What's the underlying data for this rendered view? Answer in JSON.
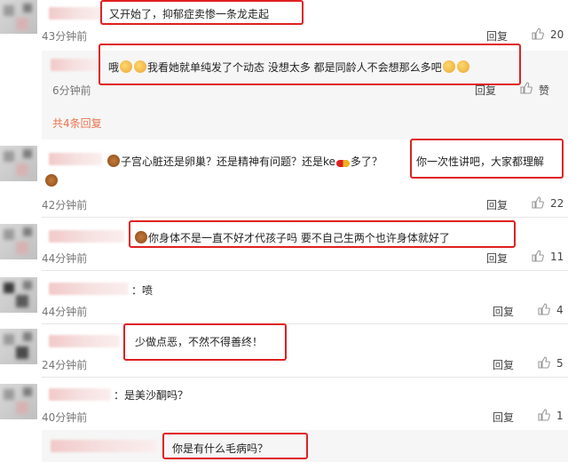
{
  "comments": [
    {
      "time": "43分钟前",
      "reply": "回复",
      "likes": "20",
      "text": "又开始了，抑郁症卖惨一条龙走起"
    },
    {
      "time": "6分钟前",
      "reply": "回复",
      "likes": "赞",
      "text": "哦我看她就单纯发了个动态 没想太多 都是同龄人不会想那么多吧"
    },
    {
      "more": "共4条回复"
    },
    {
      "time": "42分钟前",
      "reply": "回复",
      "likes": "22",
      "text_a": "子宫心脏还是卵巢？还是精神有问题？还是ke",
      "text_b": "多了？",
      "text_c": "你一次性讲吧，大家都理解"
    },
    {
      "time": "44分钟前",
      "reply": "回复",
      "likes": "11",
      "text": "你身体不是一直不好才代孩子吗  要不自己生两个也许身体就好了"
    },
    {
      "time": "44分钟前",
      "reply": "回复",
      "likes": "4",
      "text": "：喷"
    },
    {
      "time": "24分钟前",
      "reply": "回复",
      "likes": "5",
      "text": "少做点恶，不然不得善终！"
    },
    {
      "time": "40分钟前",
      "reply": "回复",
      "likes": "1",
      "text": "：是美沙酮吗？"
    },
    {
      "text": "你是有什么毛病吗？"
    }
  ],
  "colors": {
    "highlight": "#e02020",
    "more_link": "#eb7350"
  },
  "icons": {
    "thumb": "thumbs-up-icon"
  }
}
